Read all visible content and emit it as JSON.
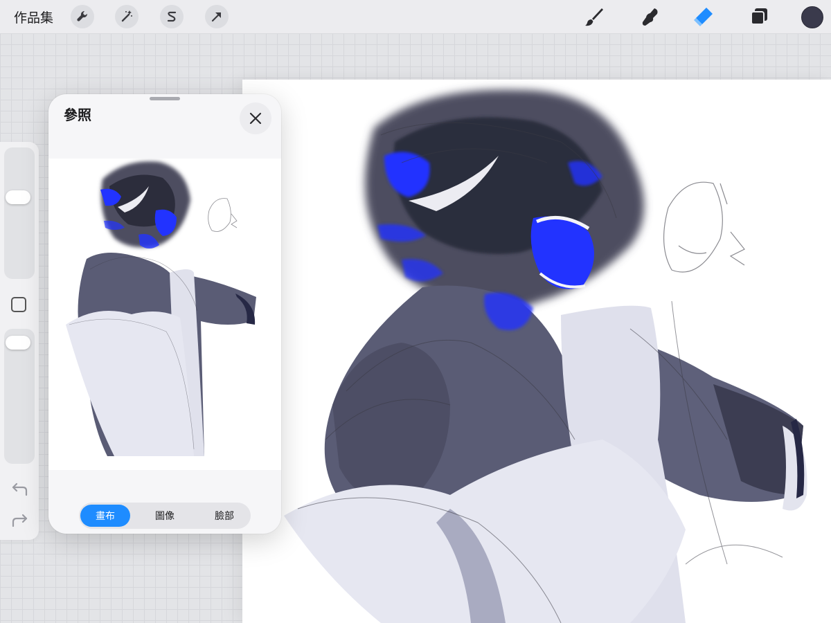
{
  "toolbar": {
    "gallery_label": "作品集",
    "left_tools": [
      "wrench-icon",
      "magic-wand-icon",
      "selection-s-icon",
      "transform-arrow-icon"
    ],
    "right_tools": [
      "brush-icon",
      "smudge-icon",
      "eraser-icon",
      "layers-icon"
    ],
    "active_tool": "eraser-icon",
    "active_color": "#3a3a4c",
    "accent_color": "#1e8cff"
  },
  "sidebar": {
    "controls": [
      "brush-size-slider",
      "modify-button",
      "opacity-slider",
      "undo-icon",
      "redo-icon"
    ]
  },
  "reference": {
    "title": "參照",
    "tabs": [
      {
        "label": "畫布",
        "active": true
      },
      {
        "label": "圖像",
        "active": false
      },
      {
        "label": "臉部",
        "active": false
      }
    ]
  },
  "canvas": {
    "background": "#ffffff",
    "palette": {
      "skin": "#585a72",
      "dark": "#2f3042",
      "shirt": "#e3e4ef",
      "shadow": "#9a9cb8",
      "accent_blue": "#2233ff"
    }
  }
}
